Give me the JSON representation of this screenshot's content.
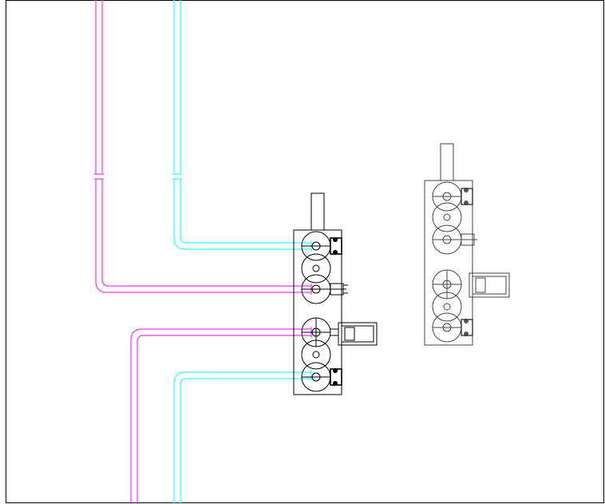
{
  "drawing": {
    "colors": {
      "pipe_magenta": "#ff33ff",
      "pipe_cyan": "#33ffff",
      "manifold_primary": "#000000",
      "manifold_secondary": "#555555",
      "background": "#ffffff"
    },
    "pipes": [
      {
        "name": "magenta-pipe-upper",
        "color": "magenta"
      },
      {
        "name": "cyan-pipe-upper",
        "color": "cyan"
      },
      {
        "name": "magenta-pipe-lower",
        "color": "magenta"
      },
      {
        "name": "cyan-pipe-lower",
        "color": "cyan"
      }
    ],
    "manifolds": [
      {
        "name": "primary-valve-manifold",
        "valve_count": 6
      },
      {
        "name": "secondary-valve-manifold",
        "valve_count": 6
      }
    ]
  }
}
